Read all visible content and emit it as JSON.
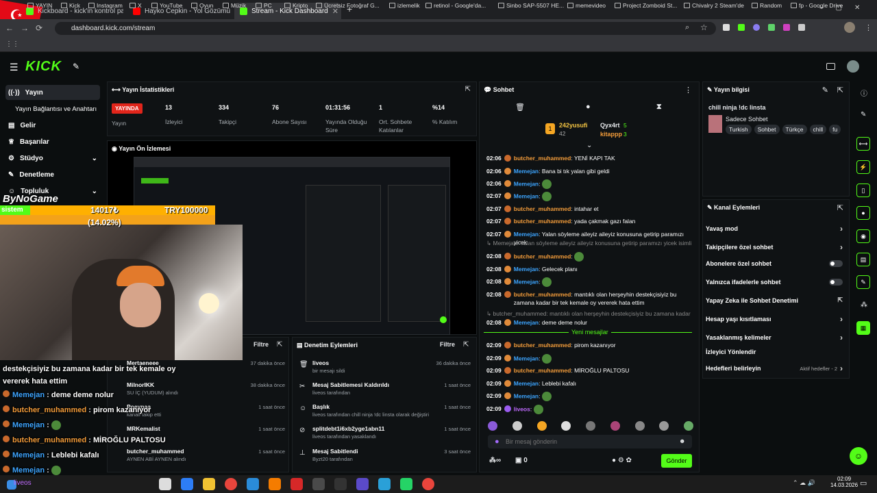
{
  "browser": {
    "tabs": [
      {
        "title": "Kickboard - kick'in kontrol pane",
        "color": "#53fc18"
      },
      {
        "title": "Hayko Cepkin - Yol Gözümü",
        "color": "#ff0000"
      },
      {
        "title": "Stream - Kick Dashboard",
        "color": "#53fc18"
      }
    ],
    "url": "dashboard.kick.com/stream",
    "bookmarks": [
      "YAYIN",
      "Kick",
      "Instagram",
      "X",
      "YouTube",
      "Oyun",
      "Müzik",
      "PC",
      "Kripto",
      "Ücretsiz Fotoğraf G...",
      "izlemelik",
      "retinol - Google'da...",
      "Sinbo SAP-5507 HE...",
      "memevideo",
      "Project Zomboid St...",
      "Chivalry 2 Steam'de",
      "Random",
      "fp - Google Drive"
    ]
  },
  "app": {
    "logo": "KICK",
    "brand_color": "#53fc18"
  },
  "nav": {
    "items": [
      {
        "label": "Yayın",
        "icon": "broadcast-icon"
      },
      {
        "label": "Yayın Bağlantısı ve Anahtarı",
        "icon": ""
      },
      {
        "label": "Gelir",
        "icon": "revenue-icon"
      },
      {
        "label": "Başarılar",
        "icon": "trophy-icon"
      },
      {
        "label": "Stüdyo",
        "icon": "studio-icon"
      },
      {
        "label": "Denetleme",
        "icon": "hammer-icon"
      },
      {
        "label": "Topluluk",
        "icon": "community-icon"
      }
    ]
  },
  "stats": {
    "title": "Yayın İstatistikleri",
    "live_badge": "YAYINDA",
    "live_label": "Yayın",
    "items": [
      {
        "value": "13",
        "label": "İzleyici"
      },
      {
        "value": "334",
        "label": "Takipçi"
      },
      {
        "value": "76",
        "label": "Abone Sayısı"
      },
      {
        "value": "01:31:56",
        "label": "Yayında Olduğu Süre"
      },
      {
        "value": "1",
        "label": "Ort. Sohbete Katılanlar"
      },
      {
        "value": "%14",
        "label": "% Katılım"
      }
    ]
  },
  "preview": {
    "title": "Yayın Ön İzlemesi"
  },
  "overlay": {
    "channel": "ByNoGame",
    "sistem": "sistem",
    "goal_current": "14017₺",
    "goal_pct": "(14.02%)",
    "goal_target": "TRY100000",
    "caption": "destekçisiyiz bu zamana kadar bir tek kemale oy vererek hata ettim",
    "chat": [
      {
        "user": "Memejan",
        "msg": "deme deme nolur",
        "color": "#3da5ff"
      },
      {
        "user": "butcher_muhammed",
        "msg": "pirom kazanıyor",
        "color": "#f39c3a"
      },
      {
        "user": "Memejan",
        "msg": "",
        "color": "#3da5ff"
      },
      {
        "user": "butcher_muhammed",
        "msg": "MİROĞLU PALTOSU",
        "color": "#f39c3a"
      },
      {
        "user": "Memejan",
        "msg": "Leblebi kafalı",
        "color": "#3da5ff"
      },
      {
        "user": "Memejan",
        "msg": "",
        "color": "#3da5ff"
      },
      {
        "user": "liveos",
        "msg": "",
        "color": "#c06bff"
      }
    ]
  },
  "followers": {
    "filter": "Filtre",
    "items": [
      {
        "name": "Mertaeneee",
        "sub": "",
        "time": "37 dakika önce"
      },
      {
        "name": "MilnorIKK",
        "sub": "SU İÇ (YUDUM) alındı",
        "time": "38 dakika önce"
      },
      {
        "name": "Poeynaa",
        "sub": "kanalı takip etti",
        "time": "1 saat önce"
      },
      {
        "name": "MRKemalist",
        "sub": "",
        "time": "1 saat önce"
      },
      {
        "name": "butcher_muhammed",
        "sub": "AYNEN ABİ AYNEN alındı",
        "time": "1 saat önce"
      }
    ]
  },
  "modlog": {
    "title": "Denetim Eylemleri",
    "filter": "Filtre",
    "items": [
      {
        "name": "liveos",
        "sub": "bir mesajı sildi",
        "time": "36 dakika önce"
      },
      {
        "name": "Mesaj Sabitlemesi Kaldırıldı",
        "sub": "liveos tarafından",
        "time": "1 saat önce"
      },
      {
        "name": "Başlık",
        "sub": "liveos tarafından chill ninja !dc linsta olarak değiştirildi",
        "time": "1 saat önce"
      },
      {
        "name": "splitdebt1i6xb2yge1abn11",
        "sub": "liveos tarafından yasaklandı",
        "time": "1 saat önce"
      },
      {
        "name": "Mesaj Sabitlendi",
        "sub": "Byzt20 tarafından",
        "time": "3 saat önce"
      }
    ]
  },
  "chat": {
    "title": "Sohbet",
    "top": [
      {
        "user": "242yusufi",
        "count": "42"
      },
      {
        "user": "Qyx4rt",
        "count": "5"
      },
      {
        "user": "kitappp",
        "count": "3"
      }
    ],
    "messages": [
      {
        "time": "02:06",
        "user": "butcher_muhammed",
        "msg": "YENİ KAPI TAK",
        "color": "#f39c3a"
      },
      {
        "time": "02:06",
        "user": "Memejan",
        "msg": "Bana bi tık yalan gibi geldi",
        "color": "#3da5ff"
      },
      {
        "time": "02:06",
        "user": "Memejan",
        "msg": "",
        "color": "#3da5ff"
      },
      {
        "time": "02:07",
        "user": "Memejan",
        "msg": "",
        "color": "#3da5ff"
      },
      {
        "time": "02:07",
        "user": "butcher_muhammed",
        "msg": "intahar et",
        "color": "#f39c3a"
      },
      {
        "time": "02:07",
        "user": "butcher_muhammed",
        "msg": "yada çakmak gazı falan",
        "color": "#f39c3a"
      },
      {
        "time": "02:07",
        "user": "Memejan",
        "msg": "Yalan söyleme aileyiz aileyiz konusuna getirip paramızı yicek",
        "color": "#3da5ff"
      },
      {
        "time": "",
        "user": "",
        "msg": "↳ Memejan: Yalan söyleme aileyiz aileyiz konusuna getirip paramızı yicek isimli kulla...",
        "color": "#888"
      },
      {
        "time": "02:08",
        "user": "butcher_muhammed",
        "msg": "",
        "color": "#f39c3a"
      },
      {
        "time": "02:08",
        "user": "Memejan",
        "msg": "Gelecek planı",
        "color": "#3da5ff"
      },
      {
        "time": "02:08",
        "user": "Memejan",
        "msg": "",
        "color": "#3da5ff"
      },
      {
        "time": "02:08",
        "user": "butcher_muhammed",
        "msg": "mantıklı olan herşeyhin destekçisiyiz bu zamana kadar bir tek kemale oy vererek hata ettim",
        "color": "#f39c3a"
      },
      {
        "time": "",
        "user": "",
        "msg": "↳ butcher_muhammed: mantıklı olan herşeyhin destekçisiyiz bu zamana kadar bir te...",
        "color": "#888"
      },
      {
        "time": "02:08",
        "user": "Memejan",
        "msg": "deme deme nolur",
        "color": "#3da5ff"
      }
    ],
    "new_divider": "Yeni mesajlar",
    "new_messages": [
      {
        "time": "02:09",
        "user": "butcher_muhammed",
        "msg": "pirom kazanıyor",
        "color": "#f39c3a"
      },
      {
        "time": "02:09",
        "user": "Memejan",
        "msg": "",
        "color": "#3da5ff"
      },
      {
        "time": "02:09",
        "user": "butcher_muhammed",
        "msg": "MİROĞLU PALTOSU",
        "color": "#f39c3a"
      },
      {
        "time": "02:09",
        "user": "Memejan",
        "msg": "Leblebi kafalı",
        "color": "#3da5ff"
      },
      {
        "time": "02:09",
        "user": "Memejan",
        "msg": "",
        "color": "#3da5ff"
      },
      {
        "time": "02:09",
        "user": "liveos",
        "msg": "",
        "color": "#c06bff"
      }
    ],
    "input_placeholder": "Bir mesaj gönderin",
    "viewers_icon_count": "∞",
    "points": "0",
    "send": "Gönder"
  },
  "info": {
    "title": "Yayın bilgisi",
    "stream_title": "chill ninja !dc linsta",
    "category": "Sadece Sohbet",
    "tags": [
      "Turkish",
      "Sohbet",
      "Türkçe",
      "chill",
      "fu"
    ]
  },
  "channel_actions": {
    "title": "Kanal Eylemleri",
    "items": [
      {
        "label": "Yavaş mod",
        "type": "arrow"
      },
      {
        "label": "Takipçilere özel sohbet",
        "type": "arrow"
      },
      {
        "label": "Abonelere özel sohbet",
        "type": "toggle"
      },
      {
        "label": "Yalnızca ifadelerle sohbet",
        "type": "toggle"
      },
      {
        "label": "Yapay Zeka ile Sohbet Denetimi",
        "type": "ext"
      },
      {
        "label": "Hesap yaşı kısıtlaması",
        "type": "arrow"
      },
      {
        "label": "Yasaklanmış kelimeler",
        "type": "arrow"
      },
      {
        "label": "İzleyici Yönlendir",
        "type": "none"
      },
      {
        "label": "Hedefleri belirleyin",
        "type": "arrow",
        "extra": "Aktif hedefler - 2"
      }
    ]
  },
  "taskbar": {
    "time": "02:09",
    "date": "14.03.2026",
    "user": "liveos"
  }
}
